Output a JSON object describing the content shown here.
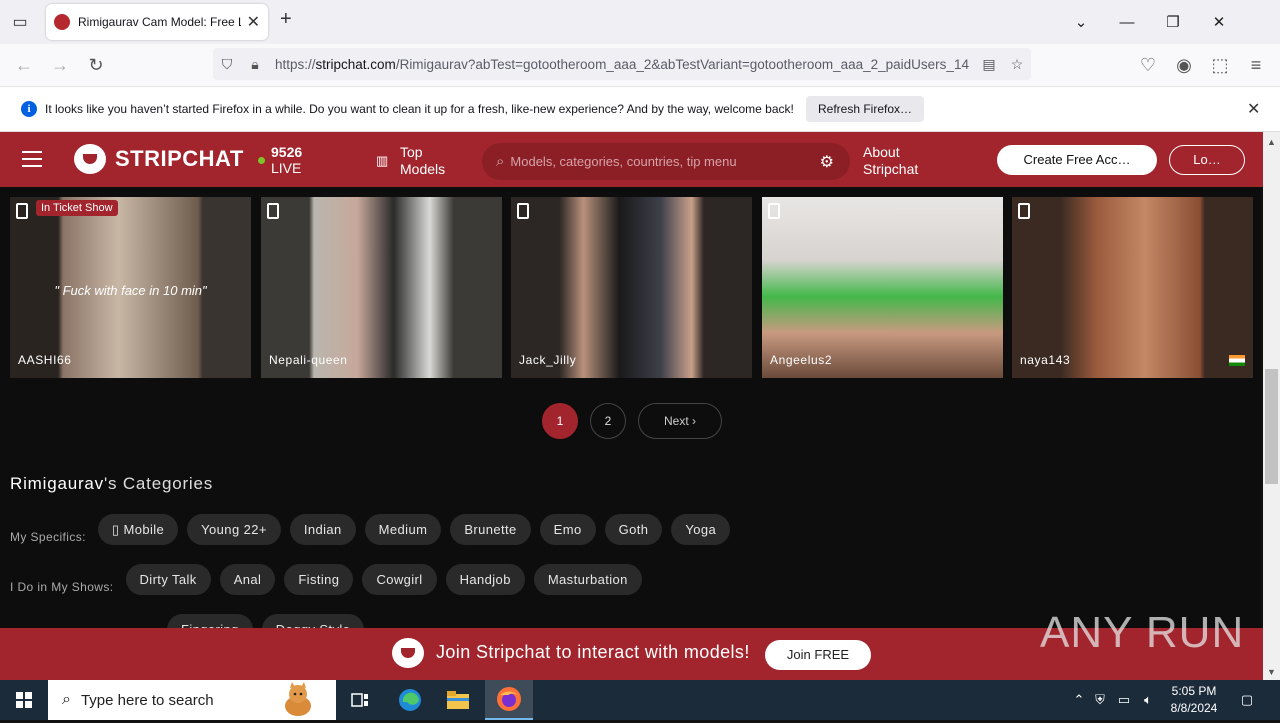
{
  "browser": {
    "tab_title": "Rimigaurav Cam Model: Free Li",
    "url_prefix": "https://",
    "url_domain": "stripchat.com",
    "url_path": "/Rimigaurav?abTest=gotootheroom_aaa_2&abTestVariant=gotootheroom_aaa_2_paidUsers_14",
    "infobar_text": "It looks like you haven’t started Firefox in a while. Do you want to clean it up for a fresh, like-new experience? And by the way, welcome back!",
    "infobar_button": "Refresh Firefox…"
  },
  "site": {
    "logo_text": "STRIPCHAT",
    "live_count": "9526",
    "live_label": "LIVE",
    "top_models_line1": "Top",
    "top_models_line2": "Models",
    "search_placeholder": "Models, categories, countries, tip menu",
    "about_line1": "About",
    "about_line2": "Stripchat",
    "create_account": "Create Free Acc…",
    "login": "Lo…",
    "accent_color": "#a2252d"
  },
  "models": [
    {
      "name": "AASHI66",
      "badge": "In Ticket Show",
      "quote": "\" Fuck with face in 10 min\""
    },
    {
      "name": "Nepali-queen"
    },
    {
      "name": "Jack_Jilly"
    },
    {
      "name": "Angeelus2"
    },
    {
      "name": "naya143",
      "flag": "india-flag"
    }
  ],
  "pagination": {
    "page1": "1",
    "page2": "2",
    "next": "Next"
  },
  "categories": {
    "owner": "Rimigaurav",
    "title_suffix": "'s Categories",
    "specifics_label": "My Specifics:",
    "specifics": [
      "Mobile",
      "Young 22+",
      "Indian",
      "Medium",
      "Brunette",
      "Emo",
      "Goth",
      "Yoga"
    ],
    "shows_label": "I Do in My Shows:",
    "shows": [
      "Dirty Talk",
      "Anal",
      "Fisting",
      "Cowgirl",
      "Handjob",
      "Masturbation"
    ],
    "more": [
      "Fingering",
      "Doggy Style"
    ]
  },
  "banner": {
    "text": "Join Stripchat to interact with models!",
    "button": "Join FREE"
  },
  "watermark": "ANY RUN",
  "taskbar": {
    "search_placeholder": "Type here to search",
    "time": "5:05 PM",
    "date": "8/8/2024"
  }
}
